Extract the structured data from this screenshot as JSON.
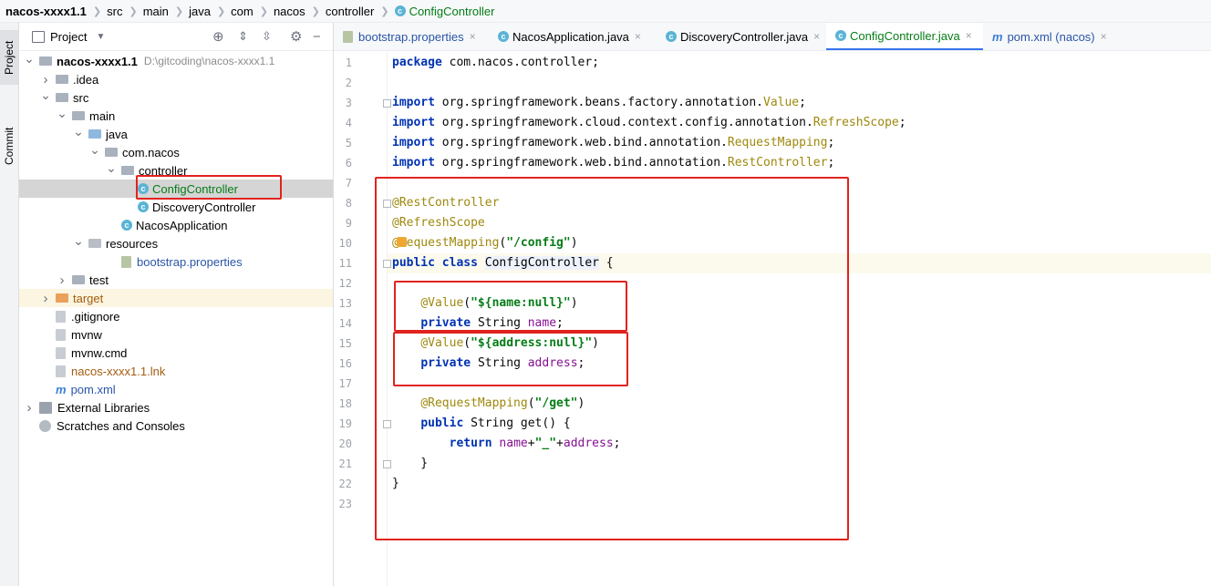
{
  "breadcrumb": [
    "nacos-xxxx1.1",
    "src",
    "main",
    "java",
    "com",
    "nacos",
    "controller",
    "ConfigController"
  ],
  "toolstrip": {
    "project_label": "Project",
    "commit_label": "Commit"
  },
  "project_panel": {
    "title": "Project",
    "rows": [
      {
        "label": "nacos-xxxx1.1",
        "hint": "D:\\gitcoding\\nacos-xxxx1.1",
        "indent": 0,
        "arrow": "down",
        "icon": "folder",
        "bold": true
      },
      {
        "label": ".idea",
        "indent": 1,
        "arrow": "right",
        "icon": "folder"
      },
      {
        "label": "src",
        "indent": 1,
        "arrow": "down",
        "icon": "folder"
      },
      {
        "label": "main",
        "indent": 2,
        "arrow": "down",
        "icon": "folder"
      },
      {
        "label": "java",
        "indent": 3,
        "arrow": "down",
        "icon": "folder-blue"
      },
      {
        "label": "com.nacos",
        "indent": 4,
        "arrow": "down",
        "icon": "package"
      },
      {
        "label": "controller",
        "indent": 5,
        "arrow": "down",
        "icon": "package"
      },
      {
        "label": "ConfigController",
        "indent": 6,
        "arrow": "none",
        "icon": "class",
        "selected": true,
        "color": "#067d17"
      },
      {
        "label": "DiscoveryController",
        "indent": 6,
        "arrow": "none",
        "icon": "class"
      },
      {
        "label": "NacosApplication",
        "indent": 5,
        "arrow": "none",
        "icon": "class-run"
      },
      {
        "label": "resources",
        "indent": 3,
        "arrow": "down",
        "icon": "folder-res"
      },
      {
        "label": "bootstrap.properties",
        "indent": 5,
        "arrow": "none",
        "icon": "properties",
        "color": "#2a55a8"
      },
      {
        "label": "test",
        "indent": 2,
        "arrow": "right",
        "icon": "folder"
      },
      {
        "label": "target",
        "indent": 1,
        "arrow": "right",
        "icon": "folder-orange",
        "color": "#a35c10",
        "highlight": true
      },
      {
        "label": ".gitignore",
        "indent": 1,
        "arrow": "none",
        "icon": "file"
      },
      {
        "label": "mvnw",
        "indent": 1,
        "arrow": "none",
        "icon": "file"
      },
      {
        "label": "mvnw.cmd",
        "indent": 1,
        "arrow": "none",
        "icon": "file"
      },
      {
        "label": "nacos-xxxx1.1.lnk",
        "indent": 1,
        "arrow": "none",
        "icon": "file",
        "color": "#a35c10"
      },
      {
        "label": "pom.xml",
        "indent": 1,
        "arrow": "none",
        "icon": "maven",
        "color": "#2a55a8"
      },
      {
        "label": "External Libraries",
        "indent": 0,
        "arrow": "right",
        "icon": "libraries"
      },
      {
        "label": "Scratches and Consoles",
        "indent": 0,
        "arrow": "none",
        "icon": "scratches"
      }
    ]
  },
  "tabs": [
    {
      "label": "bootstrap.properties",
      "icon": "properties",
      "color": "#2a55a8"
    },
    {
      "label": "NacosApplication.java",
      "icon": "class-run"
    },
    {
      "label": "DiscoveryController.java",
      "icon": "class"
    },
    {
      "label": "ConfigController.java",
      "icon": "class",
      "active": true,
      "color": "#067d17"
    },
    {
      "label": "pom.xml (nacos)",
      "icon": "maven",
      "color": "#2a55a8"
    }
  ],
  "tab_close": "×",
  "code_lines": [
    [
      [
        "kw",
        "package"
      ],
      [
        "ident",
        " com.nacos.controller;"
      ]
    ],
    [],
    [
      [
        "kw",
        "import"
      ],
      [
        "ident",
        " org.springframework.beans.factory.annotation."
      ],
      [
        "ann",
        "Value"
      ],
      [
        "ident",
        ";"
      ]
    ],
    [
      [
        "kw",
        "import"
      ],
      [
        "ident",
        " org.springframework.cloud.context.config.annotation."
      ],
      [
        "ann",
        "RefreshScope"
      ],
      [
        "ident",
        ";"
      ]
    ],
    [
      [
        "kw",
        "import"
      ],
      [
        "ident",
        " org.springframework.web.bind.annotation."
      ],
      [
        "ann",
        "RequestMapping"
      ],
      [
        "ident",
        ";"
      ]
    ],
    [
      [
        "kw",
        "import"
      ],
      [
        "ident",
        " org.springframework.web.bind.annotation."
      ],
      [
        "ann",
        "RestController"
      ],
      [
        "ident",
        ";"
      ]
    ],
    [],
    [
      [
        "ann",
        "@RestController"
      ]
    ],
    [
      [
        "ann",
        "@RefreshScope"
      ]
    ],
    [
      [
        "ann",
        "@RequestMapping"
      ],
      [
        "ident",
        "("
      ],
      [
        "str",
        "\"/config\""
      ],
      [
        "ident",
        ")"
      ]
    ],
    [
      [
        "kw",
        "public class "
      ],
      [
        "cls",
        "ConfigController"
      ],
      [
        "ident",
        " {"
      ]
    ],
    [],
    [
      [
        "ident",
        "    "
      ],
      [
        "ann",
        "@Value"
      ],
      [
        "ident",
        "("
      ],
      [
        "str",
        "\"${name:null}\""
      ],
      [
        "ident",
        ")"
      ]
    ],
    [
      [
        "ident",
        "    "
      ],
      [
        "kw",
        "private "
      ],
      [
        "ident",
        "String "
      ],
      [
        "fld",
        "name"
      ],
      [
        "ident",
        ";"
      ]
    ],
    [
      [
        "ident",
        "    "
      ],
      [
        "ann",
        "@Value"
      ],
      [
        "ident",
        "("
      ],
      [
        "str",
        "\"${address:null}\""
      ],
      [
        "ident",
        ")"
      ]
    ],
    [
      [
        "ident",
        "    "
      ],
      [
        "kw",
        "private "
      ],
      [
        "ident",
        "String "
      ],
      [
        "fld",
        "address"
      ],
      [
        "ident",
        ";"
      ]
    ],
    [],
    [
      [
        "ident",
        "    "
      ],
      [
        "ann",
        "@RequestMapping"
      ],
      [
        "ident",
        "("
      ],
      [
        "str",
        "\"/get\""
      ],
      [
        "ident",
        ")"
      ]
    ],
    [
      [
        "ident",
        "    "
      ],
      [
        "kw",
        "public "
      ],
      [
        "ident",
        "String get() {"
      ]
    ],
    [
      [
        "ident",
        "        "
      ],
      [
        "kw",
        "return "
      ],
      [
        "fld",
        "name"
      ],
      [
        "ident",
        "+"
      ],
      [
        "str",
        "\"_\""
      ],
      [
        "ident",
        "+"
      ],
      [
        "fld",
        "address"
      ],
      [
        "ident",
        ";"
      ]
    ],
    [
      [
        "ident",
        "    }"
      ]
    ],
    [
      [
        "ident",
        "}"
      ]
    ],
    []
  ],
  "current_line": 11
}
